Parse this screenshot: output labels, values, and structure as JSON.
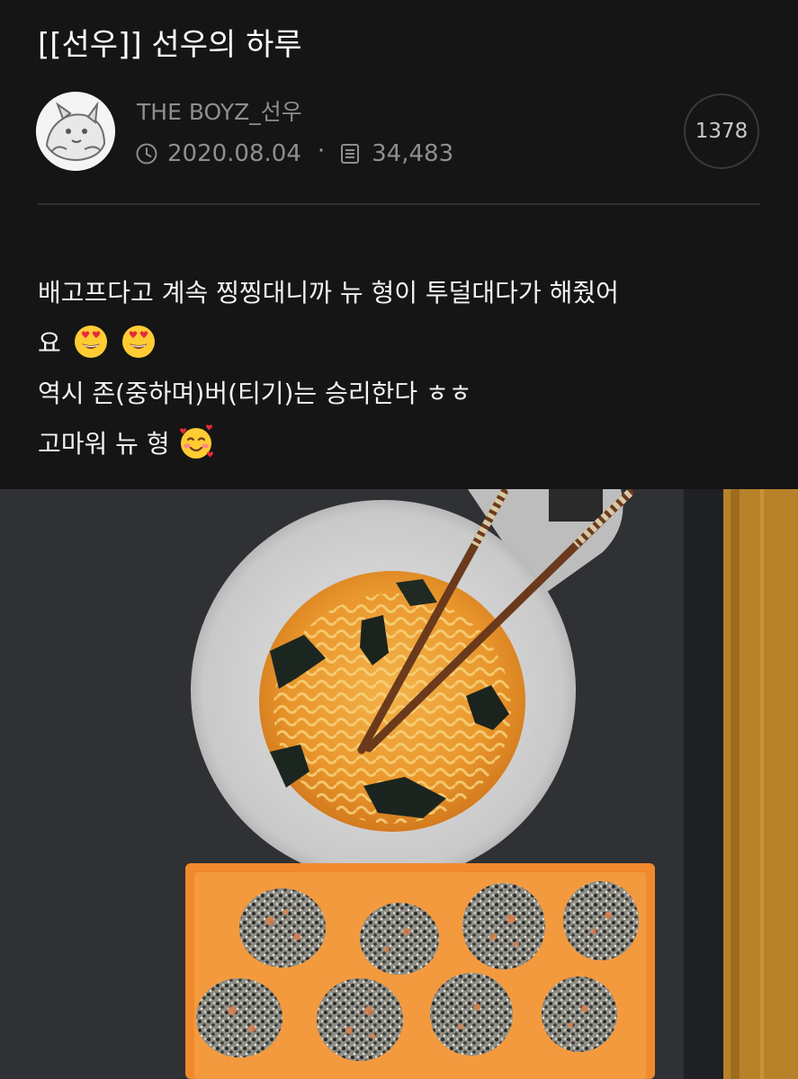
{
  "post": {
    "title": "[[선우]] 선우의 하루",
    "author": "THE BOYZ_선우",
    "date": "2020.08.04",
    "views": "34,483",
    "comment_count": "1378",
    "body": {
      "line1": "배고프다고 계속 찡찡대니까 뉴 형이 투덜대다가 해줬어",
      "line2": "요",
      "line3": "역시 존(중하며)버(티기)는 승리한다 ㅎㅎ",
      "line4": "고마워 뉴 형"
    }
  },
  "icons": {
    "clock": "clock-icon",
    "views": "document-icon",
    "emoji_heart_eyes": "heart-eyes-emoji",
    "emoji_hearts": "smiling-face-with-hearts-emoji"
  },
  "colors": {
    "background": "#151515",
    "title_text": "#ffffff",
    "meta_text": "#8e8e8e",
    "body_text": "#f2f2f2"
  }
}
